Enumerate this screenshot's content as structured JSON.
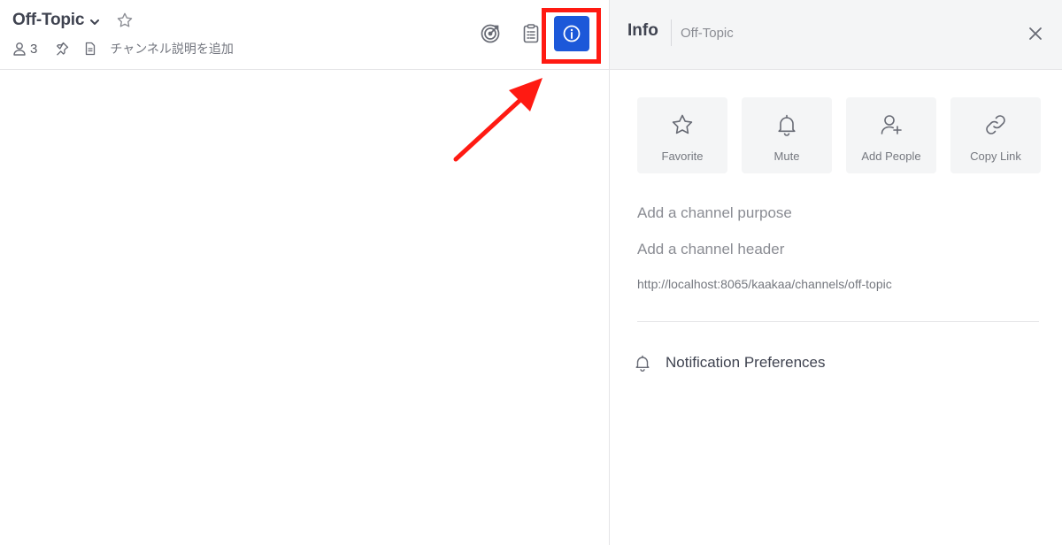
{
  "channel": {
    "name": "Off-Topic",
    "member_count": "3",
    "add_description": "チャンネル説明を追加"
  },
  "header_icons": [
    "target-icon",
    "clipboard-checklist-icon",
    "info-icon"
  ],
  "rhs": {
    "title": "Info",
    "channel_name": "Off-Topic",
    "actions": [
      {
        "label": "Favorite",
        "icon": "star-icon"
      },
      {
        "label": "Mute",
        "icon": "bell-icon"
      },
      {
        "label": "Add People",
        "icon": "add-user-icon"
      },
      {
        "label": "Copy Link",
        "icon": "link-icon"
      }
    ],
    "purpose_placeholder": "Add a channel purpose",
    "header_placeholder": "Add a channel header",
    "channel_url": "http://localhost:8065/kaakaa/channels/off-topic",
    "notification_preferences": "Notification Preferences"
  },
  "colors": {
    "accent": "#1c58d9",
    "annotation_red": "#ff1a12"
  }
}
